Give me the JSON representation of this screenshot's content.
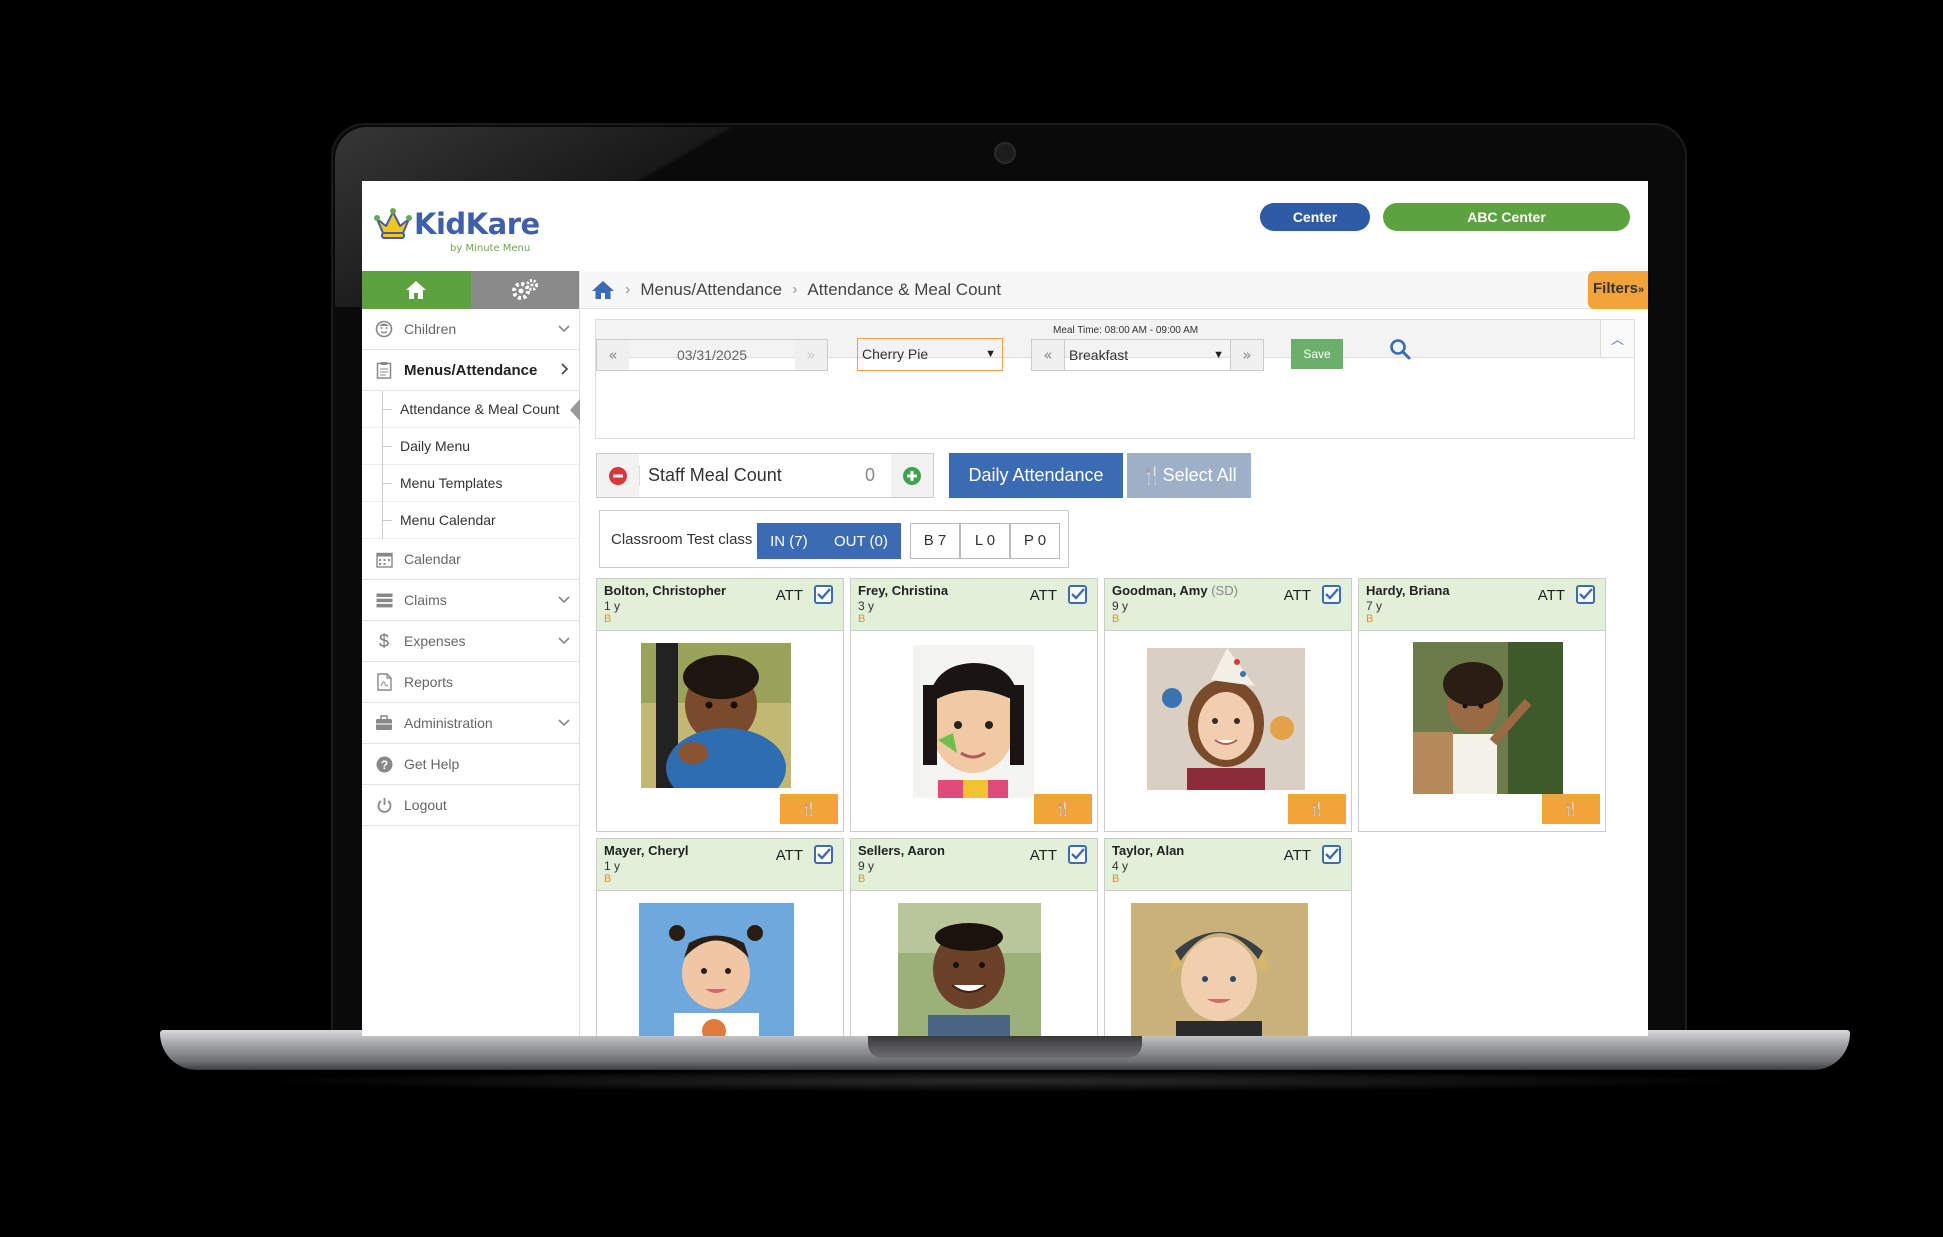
{
  "brand": {
    "name": "KidKare",
    "tagline": "by Minute Menu"
  },
  "header": {
    "center_label": "Center",
    "center_name": "ABC Center"
  },
  "colors": {
    "green": "#5ca23e",
    "blue": "#3b6bb2",
    "orange": "#f2a33a",
    "card_header": "#e2efd9"
  },
  "sidebar": {
    "tabs": [
      "home-icon",
      "gears-icon"
    ],
    "items": [
      {
        "label": "Children",
        "icon": "face-icon"
      },
      {
        "label": "Menus/Attendance",
        "icon": "clipboard-icon"
      },
      {
        "label": "Calendar",
        "icon": "calendar-icon"
      },
      {
        "label": "Claims",
        "icon": "claims-icon"
      },
      {
        "label": "Expenses",
        "icon": "dollar-icon"
      },
      {
        "label": "Reports",
        "icon": "pdf-icon"
      },
      {
        "label": "Administration",
        "icon": "briefcase-icon"
      },
      {
        "label": "Get Help",
        "icon": "help-icon"
      },
      {
        "label": "Logout",
        "icon": "power-icon"
      }
    ],
    "sub_items": [
      "Attendance & Meal Count",
      "Daily Menu",
      "Menu Templates",
      "Menu Calendar"
    ]
  },
  "breadcrumb": {
    "level1": "Menus/Attendance",
    "level2": "Attendance & Meal Count"
  },
  "filters_label": "Filters",
  "controls": {
    "date": "03/31/2025",
    "menu": "Cherry Pie",
    "meal_time": "Meal Time: 08:00 AM - 09:00 AM",
    "meal": "Breakfast",
    "save_label": "Save"
  },
  "staff": {
    "label": "Staff Meal Count",
    "count": "0"
  },
  "buttons": {
    "daily_attendance": "Daily Attendance",
    "select_all": "Select All"
  },
  "classroom": {
    "name": "Classroom Test class",
    "in": "IN (7)",
    "out": "OUT (0)",
    "b": "B 7",
    "l": "L 0",
    "p": "P 0"
  },
  "children": [
    {
      "name": "Bolton, Christopher",
      "tag": "",
      "age": "1 y",
      "meal": "B",
      "status": "ATT"
    },
    {
      "name": "Frey, Christina",
      "tag": "",
      "age": "3 y",
      "meal": "B",
      "status": "ATT"
    },
    {
      "name": "Goodman, Amy",
      "tag": "(SD)",
      "age": "9 y",
      "meal": "B",
      "status": "ATT"
    },
    {
      "name": "Hardy, Briana",
      "tag": "",
      "age": "7 y",
      "meal": "B",
      "status": "ATT"
    },
    {
      "name": "Mayer, Cheryl",
      "tag": "",
      "age": "1 y",
      "meal": "B",
      "status": "ATT"
    },
    {
      "name": "Sellers, Aaron",
      "tag": "",
      "age": "9 y",
      "meal": "B",
      "status": "ATT"
    },
    {
      "name": "Taylor, Alan",
      "tag": "",
      "age": "4 y",
      "meal": "B",
      "status": "ATT"
    }
  ]
}
